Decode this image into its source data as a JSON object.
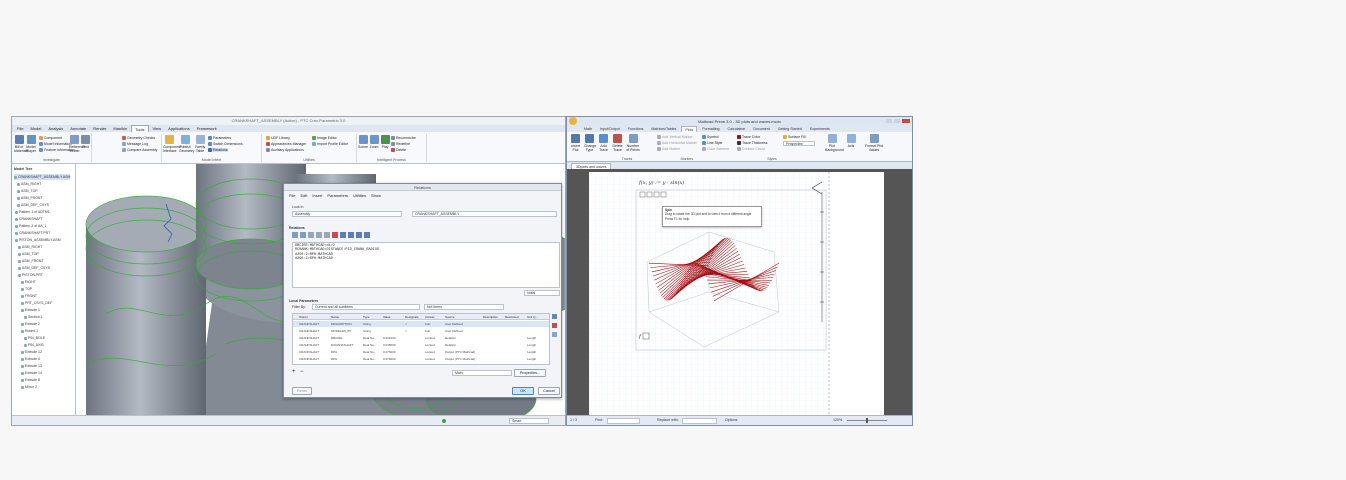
{
  "creo": {
    "title": "CRANKSHAFT_ASSEMBLY (Active) - PTC Creo Parametric 3.0",
    "tabs": [
      "File",
      "Model",
      "Analysis",
      "Annotate",
      "Render",
      "Manikin",
      "Tools",
      "View",
      "Applications",
      "Framework"
    ],
    "active_tab": "Tools",
    "ribbon": {
      "groups": [
        "Investigate",
        "Model Intent",
        "Utilities",
        "Intelligent Process"
      ],
      "large_buttons": [
        "Bill of Materials",
        "Model Player",
        "Reference Viewer",
        "Find",
        "Component Interface",
        "Publish Geometry",
        "Family Table",
        "Scene",
        "Zoom",
        "Play"
      ],
      "small_items": [
        "Component",
        "Model Information",
        "Feature Information",
        "Geometry Checks",
        "Message Log",
        "Compare Assembly",
        "Parameters",
        "Switch Dimensions",
        "Relations",
        "UDF Library",
        "Appearances Manager",
        "Auxiliary Applications",
        "Image Editor",
        "Import Profile Editor",
        "Reconnector",
        "Redefine",
        "Delete"
      ]
    },
    "tree": {
      "header": "Model Tree",
      "items": [
        "CRANKSHAFT_ASSEMBLY.ASM",
        "ASM_RIGHT",
        "ASM_TOP",
        "ASM_FRONT",
        "ASM_DEF_CSYS",
        "Pattern 1 of ADTM1",
        "CRANKSHAFT",
        "Pattern 2 of AA_1",
        "CRANKSHAFT.PRT",
        "PISTON_ASSEMBLY.ASM",
        "ASM_RIGHT",
        "ASM_TOP",
        "ASM_FRONT",
        "ASM_DEF_CSYS",
        "PISTON.PRT",
        "RIGHT",
        "TOP",
        "FRONT",
        "PRT_CSYS_DEF",
        "Extrude 1",
        "Section 1",
        "Extrude 2",
        "Round 1",
        "PIN_BOLE",
        "PIN_AXIS",
        "Extrude 12",
        "Extrude 4",
        "Extrude 13",
        "Extrude 14",
        "Extrude 8",
        "Mirror 2"
      ]
    },
    "status": {
      "filter": "Smart"
    },
    "relations_dialog": {
      "title": "Relations",
      "menu": [
        "File",
        "Edit",
        "Insert",
        "Parameters",
        "Utilities",
        "Show"
      ],
      "look_in_label": "Look In",
      "look_in_value": "Assembly",
      "scope_value": "CRANKSHAFT_ASSEMBLY",
      "relations_label": "Relations",
      "code_lines": [
        "DBCIRE:MATHCAD=d1/2",
        "RCRANK:MATHCAD=DISTANCE:PID_CRANK_RADIUS",
        "d250:2=RPH:MATHCAD",
        "d290:2=RPH:MATHCAD"
      ],
      "initial_value": "Initial",
      "local_params_label": "Local Parameters",
      "filter_by_label": "Filter By:",
      "filter_by_value": "Current and all subitems",
      "sort_value": "Not Items",
      "columns": [
        "Owner",
        "Name",
        "Type",
        "Value",
        "Designate",
        "Access",
        "Source",
        "Description",
        "Restricted",
        "Unit Q..."
      ],
      "rows": [
        [
          "CRANKSHAFT",
          "DESCRIPTION",
          "String",
          "",
          "✓",
          "Full",
          "User-Defined",
          "",
          "",
          ""
        ],
        [
          "CRANKSHAFT",
          "MODELED_BY",
          "String",
          "",
          "✓",
          "Full",
          "User-Defined",
          "",
          "",
          ""
        ],
        [
          "CRANKSHAFT",
          "DBCIRE",
          "Real Nu...",
          "0.061000",
          "",
          "Locked",
          "Relation",
          "",
          "",
          "Length"
        ],
        [
          "CRANKSHAFT",
          "RCRANKSHAFT",
          "Real Nu...",
          "0.045000",
          "",
          "Locked",
          "Relation",
          "",
          "",
          "Length"
        ],
        [
          "CRANKSHAFT",
          "RPH",
          "Real Nu...",
          "0.076000",
          "",
          "Locked",
          "Output (PTC Mathcad)",
          "",
          "",
          "Length"
        ],
        [
          "CRANKSHAFT",
          "RPH",
          "Real Nu...",
          "0.076000",
          "",
          "Locked",
          "Output (PTC Mathcad)",
          "",
          "",
          "Length"
        ]
      ],
      "main_value": "Main",
      "properties_button": "Properties...",
      "reset_button": "Reset",
      "ok_button": "OK",
      "cancel_button": "Cancel"
    }
  },
  "mathcad": {
    "title": "Mathcad Prime 3.0 - 3D plots and waves.mcdx",
    "tabs": [
      "Math",
      "Input/Output",
      "Functions",
      "Matrices/Tables",
      "Plots",
      "Formatting",
      "Calculation",
      "Document",
      "Getting Started",
      "Experiments"
    ],
    "active_tab": "Plots",
    "ribbon_items": [
      "Insert Plot",
      "Change Type",
      "Add Trace",
      "Delete Trace",
      "Number of Points",
      "Add Vertical Marker",
      "Add Horizontal Marker",
      "Add Marker",
      "Symbol",
      "Line Style",
      "Color Scheme",
      "Trace Color",
      "Trace Thickness",
      "Contour Count",
      "Surface Fill",
      "Perspective",
      "Plot Background",
      "Axis",
      "Format Plot Values"
    ],
    "ribbon_groups": [
      "Traces",
      "Markers",
      "Styles"
    ],
    "doc_tab": "3Dplots and waves",
    "formula": "f(x, y) := y · sin(x)",
    "tooltip": {
      "title": "Spin",
      "body": "Drag to rotate the 3D plot and to view it from a different angle.",
      "help": "Press F1 for help."
    },
    "status": {
      "page": "1 / 3",
      "find_label": "Find:",
      "replace_label": "Replace with:",
      "options": "Options",
      "zoom": "120%"
    },
    "colors": {
      "surface": "#a30d12"
    }
  }
}
